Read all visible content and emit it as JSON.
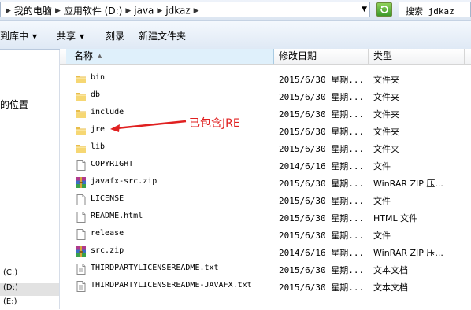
{
  "address": {
    "crumbs": [
      "我的电脑",
      "应用软件 (D:)",
      "java",
      "jdkaz"
    ],
    "search": "搜索 jdkaz"
  },
  "toolbar": {
    "library": "到库中",
    "share": "共享",
    "burn": "刻录",
    "new_folder": "新建文件夹"
  },
  "nav": {
    "location": "的位置",
    "drives": [
      "(C:)",
      "(D:)",
      "(E:)"
    ]
  },
  "columns": {
    "name": "名称",
    "date": "修改日期",
    "type": "类型"
  },
  "files": [
    {
      "name": "bin",
      "date": "2015/6/30 星期...",
      "type": "文件夹",
      "icon": "folder-icon"
    },
    {
      "name": "db",
      "date": "2015/6/30 星期...",
      "type": "文件夹",
      "icon": "folder-icon"
    },
    {
      "name": "include",
      "date": "2015/6/30 星期...",
      "type": "文件夹",
      "icon": "folder-icon"
    },
    {
      "name": "jre",
      "date": "2015/6/30 星期...",
      "type": "文件夹",
      "icon": "folder-icon"
    },
    {
      "name": "lib",
      "date": "2015/6/30 星期...",
      "type": "文件夹",
      "icon": "folder-icon"
    },
    {
      "name": "COPYRIGHT",
      "date": "2014/6/16 星期...",
      "type": "文件",
      "icon": "file-icon"
    },
    {
      "name": "javafx-src.zip",
      "date": "2015/6/30 星期...",
      "type": "WinRAR ZIP 压...",
      "icon": "winrar-icon"
    },
    {
      "name": "LICENSE",
      "date": "2015/6/30 星期...",
      "type": "文件",
      "icon": "file-icon"
    },
    {
      "name": "README.html",
      "date": "2015/6/30 星期...",
      "type": "HTML 文件",
      "icon": "file-icon"
    },
    {
      "name": "release",
      "date": "2015/6/30 星期...",
      "type": "文件",
      "icon": "file-icon"
    },
    {
      "name": "src.zip",
      "date": "2014/6/16 星期...",
      "type": "WinRAR ZIP 压...",
      "icon": "winrar-icon"
    },
    {
      "name": "THIRDPARTYLICENSEREADME.txt",
      "date": "2015/6/30 星期...",
      "type": "文本文档",
      "icon": "text-file-icon"
    },
    {
      "name": "THIRDPARTYLICENSEREADME-JAVAFX.txt",
      "date": "2015/6/30 星期...",
      "type": "文本文档",
      "icon": "text-file-icon"
    }
  ],
  "annotation": "已包含JRE",
  "colors": {
    "annotation": "#e02020",
    "folder": "#f2cf6a",
    "header_selected": "#dff0fb"
  }
}
